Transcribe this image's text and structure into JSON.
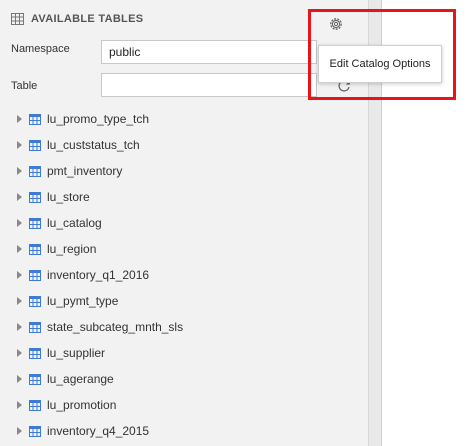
{
  "header": {
    "title": "AVAILABLE TABLES",
    "icon": "grid-table-icon"
  },
  "namespace": {
    "label": "Namespace",
    "value": "public"
  },
  "table_search": {
    "label": "Table",
    "value": "",
    "placeholder": ""
  },
  "tooltip": {
    "text": "Edit Catalog Options"
  },
  "colors": {
    "highlight": "#e8141a",
    "table_icon": "#3d7bd6",
    "panel_bg": "#f2f2f2"
  },
  "tables": [
    {
      "label": "lu_promo_type_tch"
    },
    {
      "label": "lu_custstatus_tch"
    },
    {
      "label": "pmt_inventory"
    },
    {
      "label": "lu_store"
    },
    {
      "label": "lu_catalog"
    },
    {
      "label": "lu_region"
    },
    {
      "label": "inventory_q1_2016"
    },
    {
      "label": "lu_pymt_type"
    },
    {
      "label": "state_subcateg_mnth_sls"
    },
    {
      "label": "lu_supplier"
    },
    {
      "label": "lu_agerange"
    },
    {
      "label": "lu_promotion"
    },
    {
      "label": "inventory_q4_2015"
    }
  ]
}
